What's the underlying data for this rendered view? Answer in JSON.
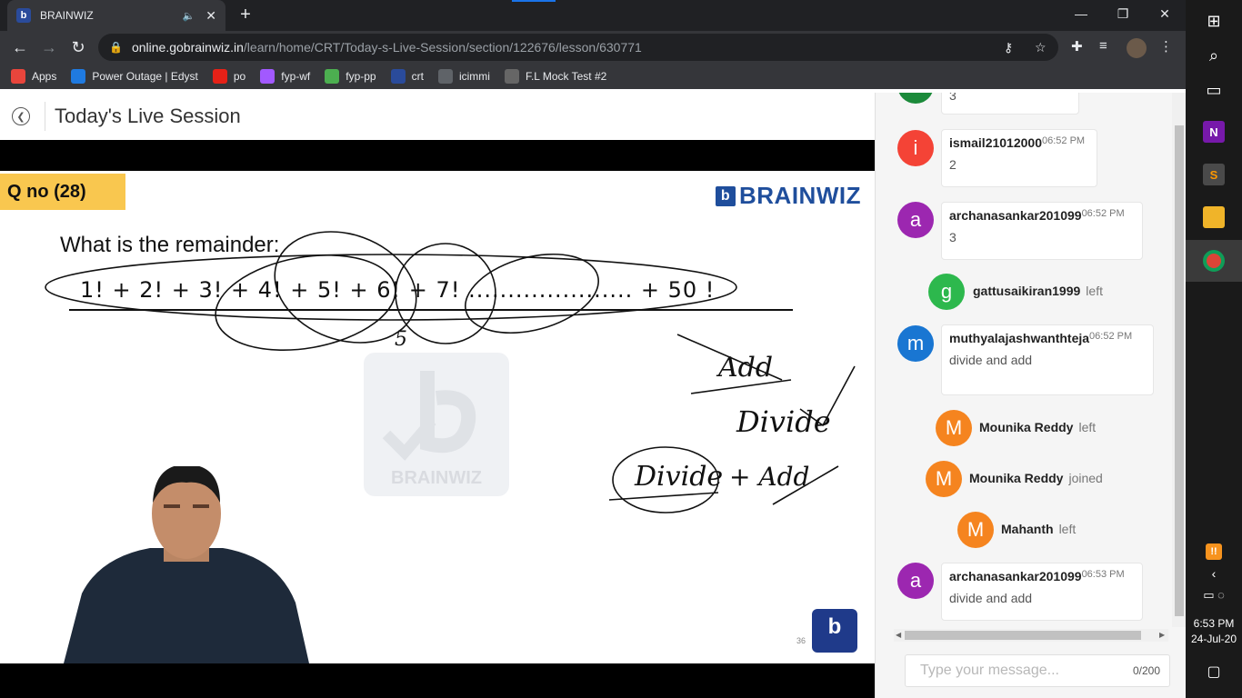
{
  "browser": {
    "tab_title": "BRAINWIZ",
    "tab_favicon": "b",
    "url_host": "online.gobrainwiz.in",
    "url_path": "/learn/home/CRT/Today-s-Live-Session/section/122676/lesson/630771",
    "bookmarks": [
      {
        "label": "Apps",
        "icon": "apps-grid-icon",
        "color": "#e8453c"
      },
      {
        "label": "Power Outage | Edyst",
        "icon": "e-icon",
        "color": "#1f7ae0"
      },
      {
        "label": "po",
        "icon": "youtube-icon",
        "color": "#e62117"
      },
      {
        "label": "fyp-wf",
        "icon": "figma-icon",
        "color": "#a259ff"
      },
      {
        "label": "fyp-pp",
        "icon": "pd-icon",
        "color": "#4caf50"
      },
      {
        "label": "crt",
        "icon": "brainwiz-icon",
        "color": "#2a4b9b"
      },
      {
        "label": "icimmi",
        "icon": "globe-icon",
        "color": "#5f6368"
      },
      {
        "label": "F.L Mock Test #2",
        "icon": "cc-icon",
        "color": "#666666"
      }
    ]
  },
  "page": {
    "title": "Today's Live Session"
  },
  "slide": {
    "qno": "Q no (28)",
    "brand": "BRAINWIZ",
    "question": "What is the remainder:",
    "expression": "1!  + 2!  +  3!   + 4! + 5!  + 6!  +  7!  .....................  + 50 !",
    "ink_notes": [
      "5",
      "Add",
      "Divide",
      "Divide",
      "+ Add"
    ],
    "watermark": "BRAINWIZ",
    "slide_number": "36"
  },
  "chat": {
    "messages": [
      {
        "type": "msg",
        "avatar": "",
        "color": "#1b8a3a",
        "user": "",
        "time": "",
        "text": "3"
      },
      {
        "type": "msg",
        "avatar": "i",
        "color": "#f44336",
        "user": "ismail21012000",
        "time": "06:52 PM",
        "text": "2"
      },
      {
        "type": "msg",
        "avatar": "a",
        "color": "#9c27b0",
        "user": "archanasankar201099",
        "time": "06:52 PM",
        "text": "3"
      },
      {
        "type": "evt",
        "avatar": "g",
        "color": "#2db84d",
        "user": "gattusaikiran1999",
        "action": "left"
      },
      {
        "type": "msg",
        "avatar": "m",
        "color": "#1976d2",
        "user": "muthyalajashwanthteja",
        "time": "06:52 PM",
        "text": "divide and add"
      },
      {
        "type": "evt",
        "avatar": "M",
        "color": "#f5841f",
        "user": "Mounika Reddy",
        "action": "left"
      },
      {
        "type": "evt",
        "avatar": "M",
        "color": "#f5841f",
        "user": "Mounika Reddy",
        "action": "joined"
      },
      {
        "type": "evt",
        "avatar": "M",
        "color": "#f5841f",
        "user": "Mahanth",
        "action": "left"
      },
      {
        "type": "msg",
        "avatar": "a",
        "color": "#9c27b0",
        "user": "archanasankar201099",
        "time": "06:53 PM",
        "text": "divide and add"
      }
    ],
    "input_placeholder": "Type your message...",
    "counter": "0/200"
  },
  "taskbar": {
    "time": "6:53 PM",
    "date": "24-Jul-20"
  }
}
